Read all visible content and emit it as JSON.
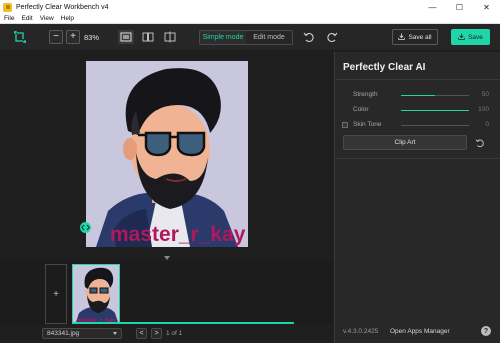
{
  "window": {
    "title": "Perfectly Clear Workbench v4",
    "controls": [
      "—",
      "☐",
      "✕"
    ]
  },
  "menu": {
    "items": [
      "File",
      "Edit",
      "View",
      "Help"
    ]
  },
  "toolbar": {
    "zoom_out": "−",
    "zoom_in": "+",
    "zoom_level": "83%",
    "modes": {
      "simple": "Simple mode",
      "edit": "Edit mode",
      "active": "simple"
    },
    "save_all": "Save all",
    "save": "Save"
  },
  "canvas": {
    "watermark_text": "master_r_kay"
  },
  "filmstrip": {
    "add_label": "+"
  },
  "bottombar": {
    "filename": "843341.jpg",
    "prev": "<",
    "next": ">",
    "page_info": "1 of 1"
  },
  "panel": {
    "title": "Perfectly Clear AI",
    "sliders": [
      {
        "label": "Strength",
        "value": "50",
        "fraction": 0.5
      },
      {
        "label": "Color",
        "value": "100",
        "fraction": 1.0
      },
      {
        "label": "Skin Tone",
        "value": "0",
        "fraction": 0.0
      }
    ],
    "skin_tone_checked": false,
    "clip_art": "Clip Art",
    "version": "v.4.3.0.2425",
    "apps_manager": "Open Apps Manager",
    "help": "?"
  },
  "colors": {
    "accent": "#20d6a8",
    "background": "#202020",
    "panel": "#282828"
  }
}
